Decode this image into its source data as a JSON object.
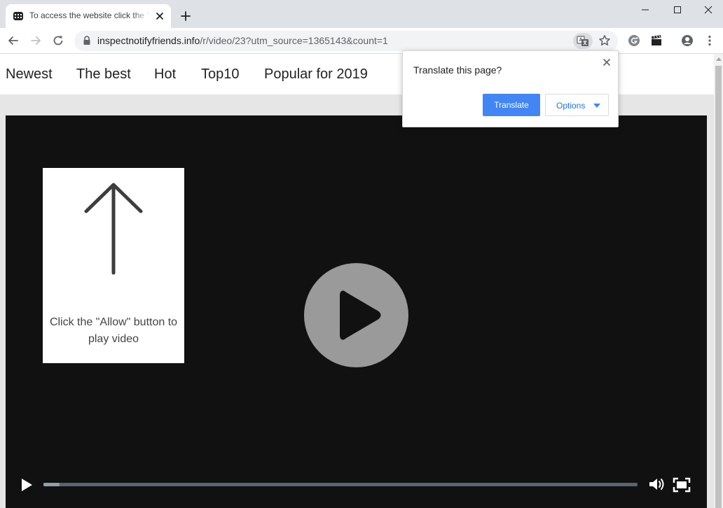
{
  "browser": {
    "tab": {
      "title": "To access the website click the \"Allow\" button"
    },
    "address_bar": {
      "host": "inspectnotifyfriends.info",
      "path": "/r/video/23?utm_source=1365143&count=1"
    }
  },
  "site_nav": {
    "items": [
      {
        "label": "Newest"
      },
      {
        "label": "The best"
      },
      {
        "label": "Hot"
      },
      {
        "label": "Top10"
      },
      {
        "label": "Popular for 2019"
      }
    ]
  },
  "allow_prompt": {
    "text": "Click the \"Allow\" button to play video"
  },
  "video_player": {
    "progress_fraction": 0.027
  },
  "translate_bubble": {
    "title": "Translate this page?",
    "translate_label": "Translate",
    "options_label": "Options"
  },
  "colors": {
    "accent": "#4285f4",
    "player_bg": "#111111",
    "tab_strip": "#dee1e6"
  }
}
